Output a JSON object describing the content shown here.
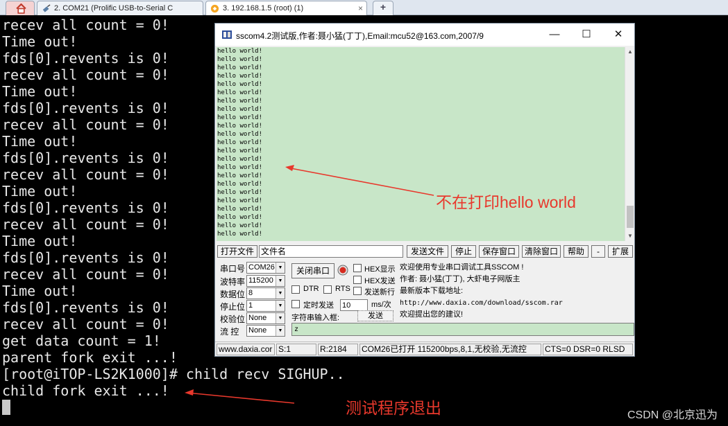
{
  "tabs": [
    {
      "label": "2. COM21 (Prolific USB-to-Serial C",
      "close": "×"
    },
    {
      "label": "3. 192.168.1.5 (root) (1)",
      "close": "×"
    }
  ],
  "new_tab_symbol": "+",
  "terminal_lines": [
    "recev all count = 0!",
    "Time out!",
    "fds[0].revents is 0!",
    "recev all count = 0!",
    "Time out!",
    "fds[0].revents is 0!",
    "recev all count = 0!",
    "Time out!",
    "fds[0].revents is 0!",
    "recev all count = 0!",
    "Time out!",
    "fds[0].revents is 0!",
    "recev all count = 0!",
    "Time out!",
    "fds[0].revents is 0!",
    "recev all count = 0!",
    "Time out!",
    "fds[0].revents is 0!",
    "recev all count = 0!",
    "get data count = 1!",
    "parent fork exit ...!",
    "[root@iTOP-LS2K1000]# child recv SIGHUP..",
    "child fork exit ...!"
  ],
  "sscom": {
    "title": "sscom4.2测试版,作者:聂小猛(丁丁),Email:mcu52@163.com,2007/9",
    "window_buttons": {
      "minimize": "—",
      "maximize": "☐",
      "close": "✕"
    },
    "recv_line": "hello world!",
    "recv_line_count": 23,
    "toolbar": {
      "open_file": "打开文件",
      "filename": "文件名",
      "send_file": "发送文件",
      "stop": "停止",
      "save_window": "保存窗口",
      "clear_window": "清除窗口",
      "help": "帮助",
      "minus": "-",
      "expand": "扩展"
    },
    "settings": {
      "port_label": "串口号",
      "port_value": "COM26",
      "baud_label": "波特率",
      "baud_value": "115200",
      "databits_label": "数据位",
      "databits_value": "8",
      "stopbits_label": "停止位",
      "stopbits_value": "1",
      "parity_label": "校验位",
      "parity_value": "None",
      "flow_label": "流 控",
      "flow_value": "None"
    },
    "close_port_button": "关闭串口",
    "hex_display": "HEX显示",
    "hex_send": "HEX发送",
    "dtr": "DTR",
    "rts": "RTS",
    "send_newline": "发送新行",
    "timed_send": "定时发送",
    "interval_value": "10",
    "interval_unit": "ms/次",
    "string_input_label": "字符串输入框:",
    "send_button": "发送",
    "info": [
      "欢迎使用专业串口调试工具SSCOM !",
      "作者: 聂小猛(丁丁), 大虾电子网版主",
      "最新版本下载地址:",
      "http://www.daxia.com/download/sscom.rar",
      "欢迎提出您的建议!"
    ],
    "send_text": "z",
    "status": {
      "site": "www.daxia.cor",
      "s": "S:1",
      "r": "R:2184",
      "port": "COM26已打开  115200bps,8,1,无校验,无流控",
      "lines": "CTS=0 DSR=0 RLSD"
    }
  },
  "annotations": {
    "hello": "不在打印hello world",
    "exit": "测试程序退出"
  },
  "watermark": "CSDN @北京迅为",
  "colors": {
    "annotation": "#e8382c",
    "recv_bg": "#c8e6c8",
    "terminal_bg": "#000000"
  }
}
